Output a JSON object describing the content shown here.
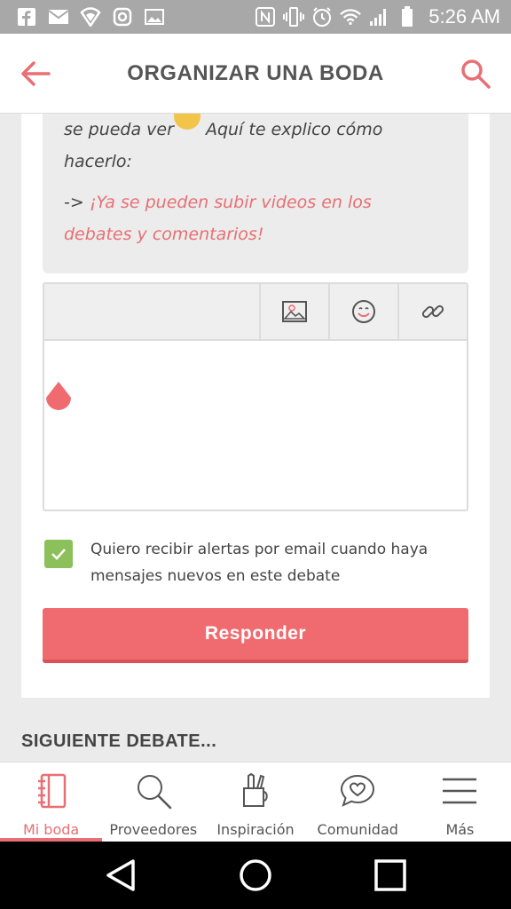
{
  "status_bar": {
    "time": "5:26 AM",
    "left_icons": [
      "facebook-icon",
      "email-icon",
      "vpn-shield-icon",
      "instagram-icon",
      "image-icon"
    ],
    "right_icons": [
      "nfc-icon",
      "vibrate-icon",
      "alarm-icon",
      "wifi-icon",
      "signal-icon",
      "battery-icon"
    ]
  },
  "app_bar": {
    "title": "ORGANIZAR UNA BODA",
    "back_icon": "arrow-left-icon",
    "search_icon": "search-icon",
    "accent": "#e86f74"
  },
  "quote": {
    "line1_prefix": "se pueda ver",
    "line1_suffix": " Aquí te explico cómo",
    "line2": "hacerlo:",
    "arrow": "-> ",
    "highlight_line1": "¡Ya se pueden subir videos en los",
    "highlight_line2": "debates y comentarios!"
  },
  "editor": {
    "toolbar": [
      "image-icon",
      "smiley-icon",
      "link-icon"
    ],
    "value": ""
  },
  "alerts": {
    "checked": true,
    "label_line1": "Quiero recibir alertas por email cuando haya",
    "label_line2": "mensajes nuevos en este debate"
  },
  "reply_button": {
    "label": "Responder",
    "color": "#f06b70"
  },
  "next_debate": {
    "title": "SIGUIENTE DEBATE..."
  },
  "bottom_nav": {
    "items": [
      {
        "label": "Mi boda",
        "icon": "notebook-icon",
        "active": true
      },
      {
        "label": "Proveedores",
        "icon": "search-icon",
        "active": false
      },
      {
        "label": "Inspiración",
        "icon": "pencil-cup-icon",
        "active": false
      },
      {
        "label": "Comunidad",
        "icon": "chat-heart-icon",
        "active": false
      },
      {
        "label": "Más",
        "icon": "menu-icon",
        "active": false
      }
    ]
  },
  "system_nav": [
    "back-triangle-icon",
    "home-circle-icon",
    "recents-square-icon"
  ]
}
